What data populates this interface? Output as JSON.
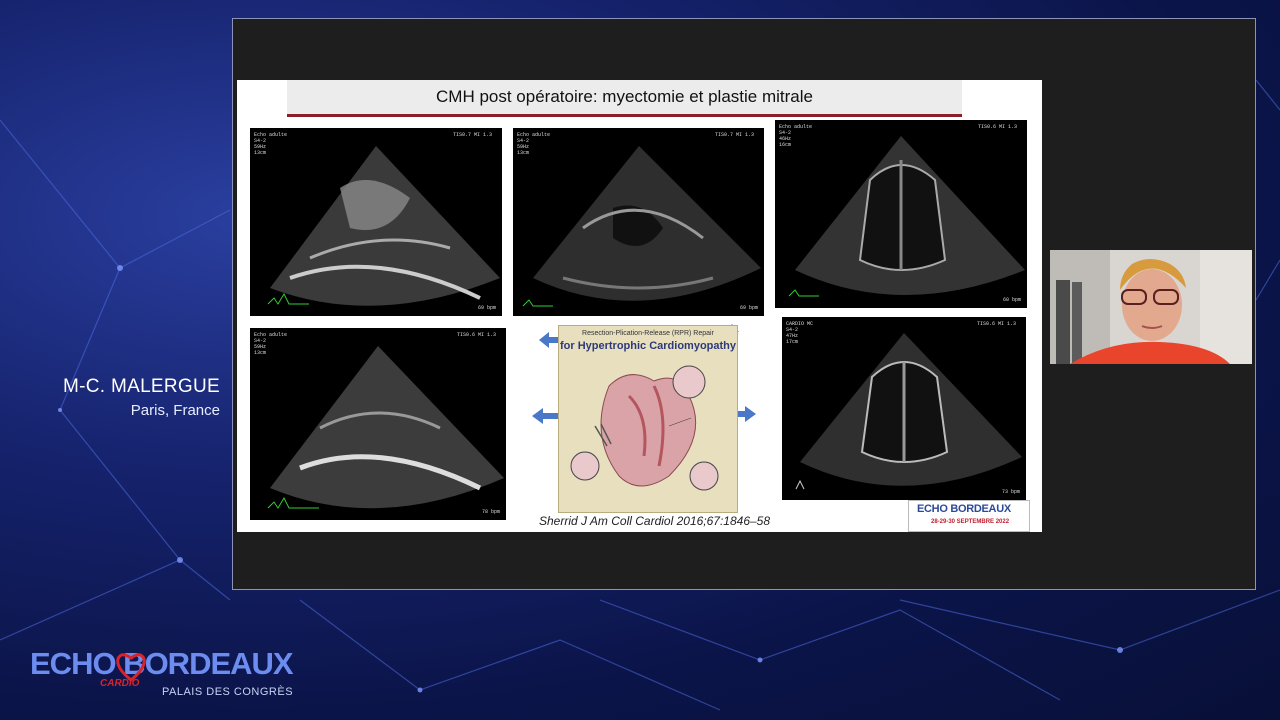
{
  "speaker": {
    "name": "M-C. MALERGUE",
    "location": "Paris, France"
  },
  "slide": {
    "title": "CMH post opératoire: myectomie et plastie mitrale",
    "citation": "Sherrid J Am Coll Cardiol 2016;67:1846–58",
    "echos": [
      {
        "header": "Echo adulte\nS4-2\n59Hz\n13cm",
        "tis": "TIS0.7  MI 1.3",
        "bpm": "69 bpm"
      },
      {
        "header": "Echo adulte\nS4-2\n59Hz\n13cm",
        "tis": "TIS0.7  MI 1.3",
        "bpm": "69 bpm"
      },
      {
        "header": "Echo adulte\nS4-2\n46Hz\n16cm",
        "tis": "TIS0.6  MI 1.3",
        "bpm": "60 bpm"
      },
      {
        "header": "Echo adulte\nS4-2\n59Hz\n13cm",
        "tis": "TIS0.6  MI 1.3",
        "bpm": "78 bpm"
      },
      {
        "header": "CARDIO MC\nS4-2\n47Hz\n17cm",
        "tis": "TIS0.6  MI 1.3",
        "bpm": "73 bpm"
      }
    ],
    "diagram": {
      "subtitle": "Resection-Plication-Release (RPR) Repair",
      "title": "for Hypertrophic Cardiomyopathy"
    },
    "conference_logo": {
      "name": "ECHO BORDEAUX",
      "dates": "28-29-30 SEPTEMBRE 2022"
    }
  },
  "branding": {
    "logo_text": "ECHO BORDEAUX",
    "cardio": "CARDIO",
    "venue": "PALAIS DES CONGRÈS"
  },
  "colors": {
    "accent": "#8b1e2b",
    "logo_blue": "#6d8cf0",
    "arrow_blue": "#4a78c8"
  }
}
